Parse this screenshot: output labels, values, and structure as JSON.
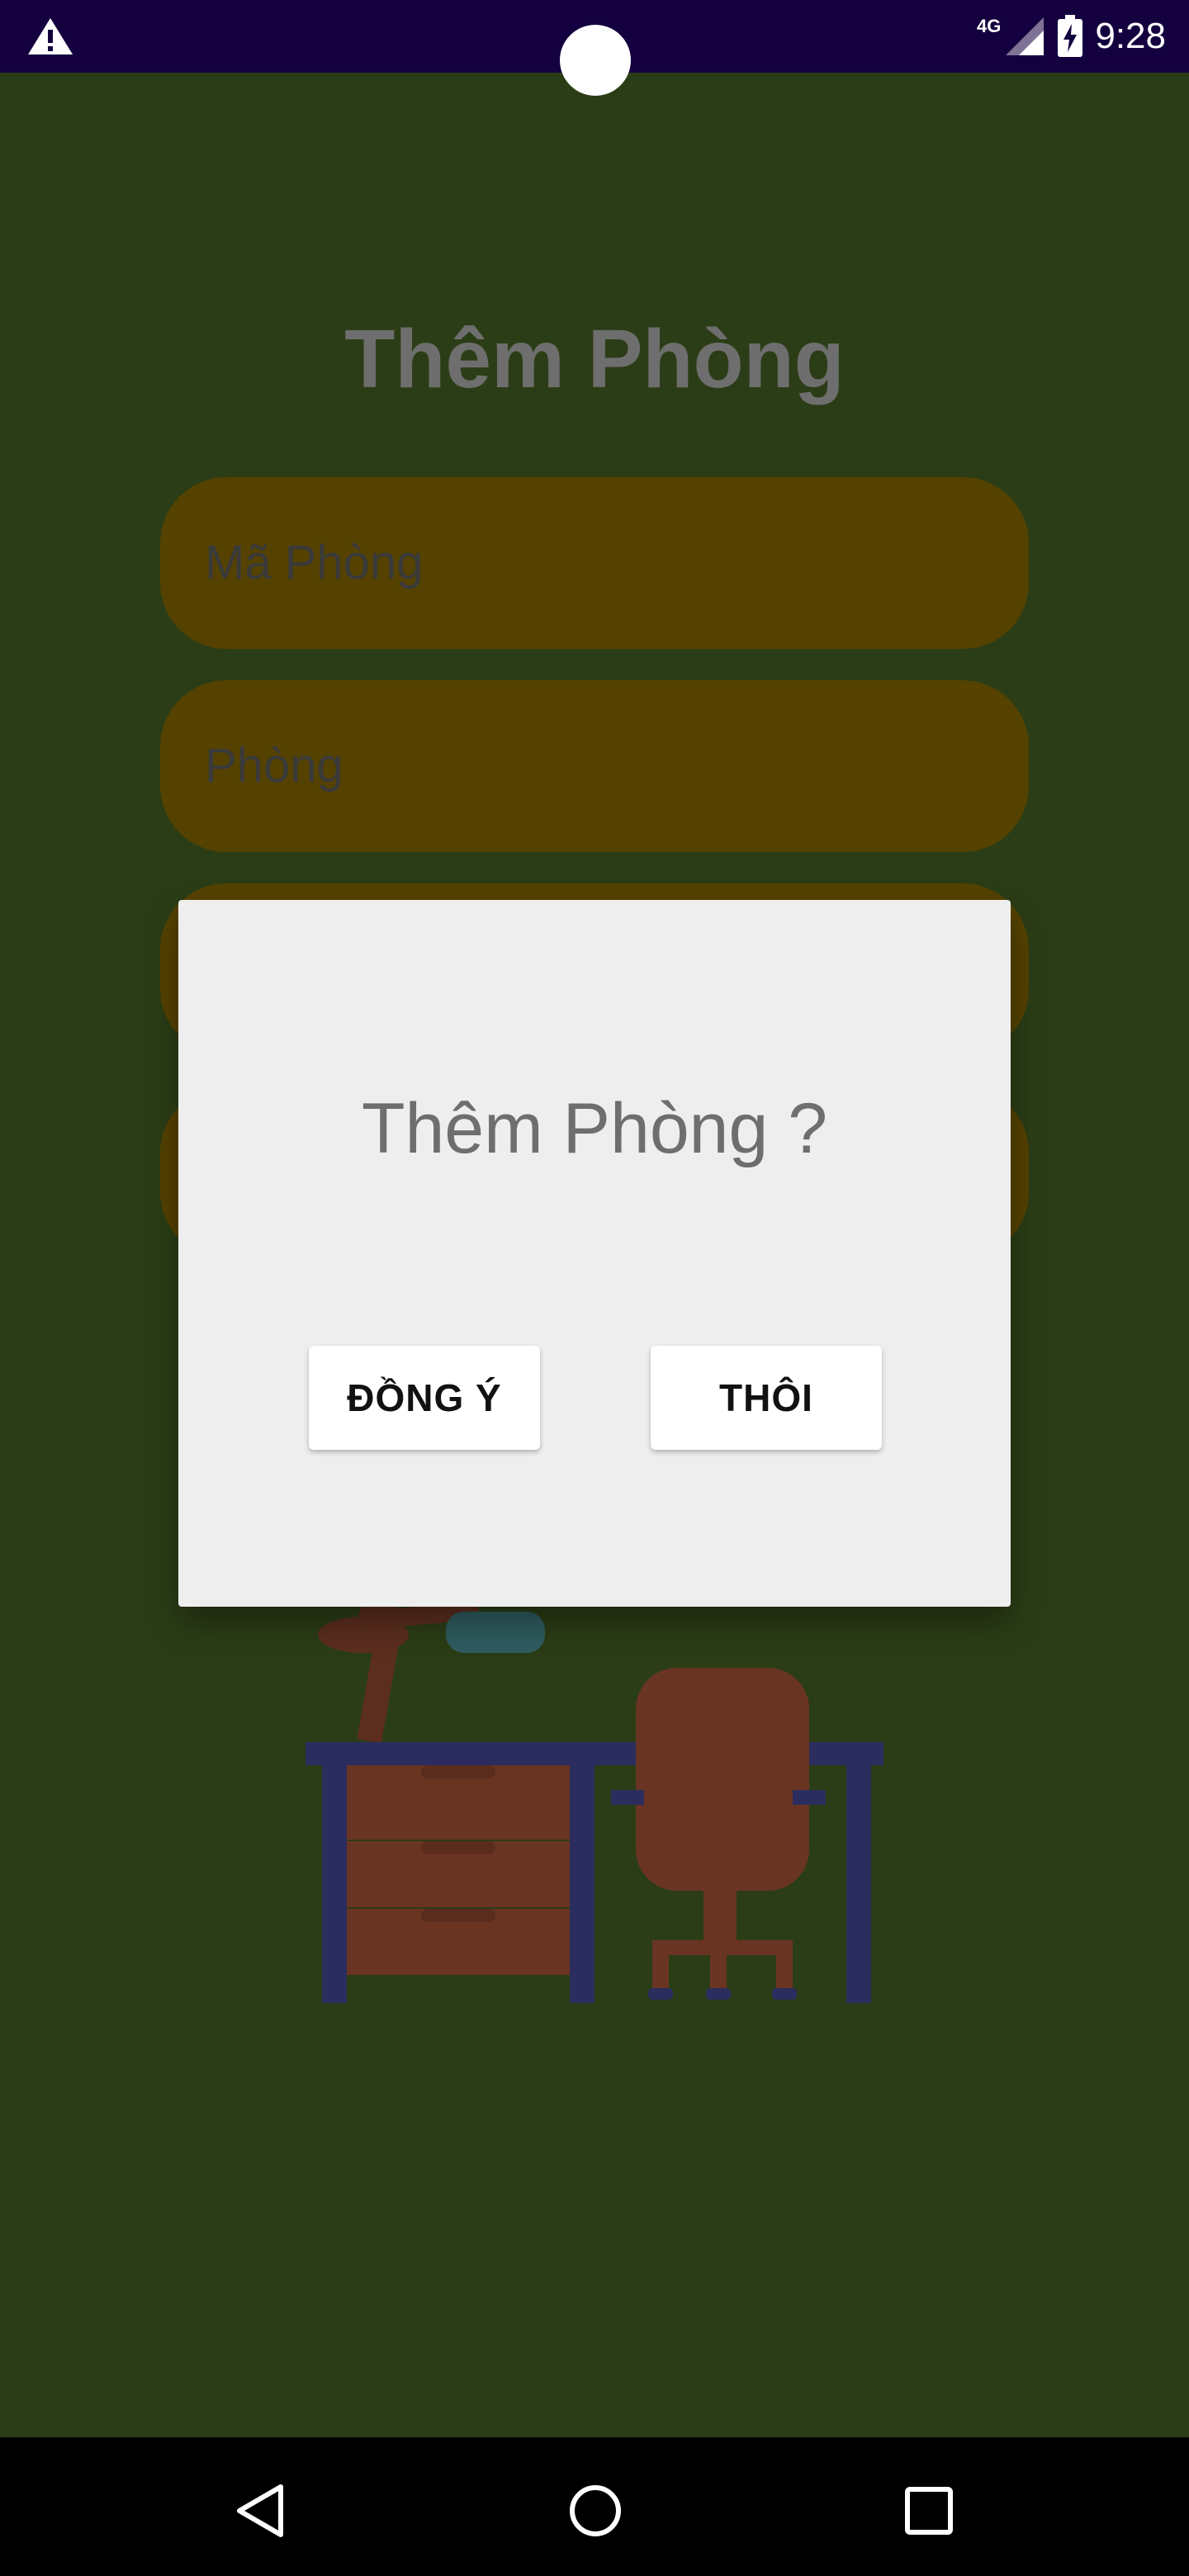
{
  "status_bar": {
    "network": "4G",
    "time": "9:28",
    "icons": [
      "warning-icon",
      "signal-icon",
      "battery-charging-icon"
    ]
  },
  "screen": {
    "title": "Thêm Phòng",
    "fields": [
      {
        "label": "Mã Phòng"
      },
      {
        "label": "Phòng"
      },
      {
        "label": ""
      },
      {
        "label": ""
      }
    ],
    "illustration": "desk-chair-illustration"
  },
  "dialog": {
    "title": "Thêm Phòng ?",
    "confirm_label": "ĐỒNG Ý",
    "cancel_label": "THÔI"
  },
  "nav_bar": {
    "icons": [
      "back-icon",
      "home-icon",
      "recents-icon"
    ]
  },
  "colors": {
    "status_bar_bg": "#14003f",
    "screen_bg": "#2b3d16",
    "field_bg": "#554200",
    "dialog_bg": "#eeeeee",
    "nav_bar_bg": "#000000"
  }
}
